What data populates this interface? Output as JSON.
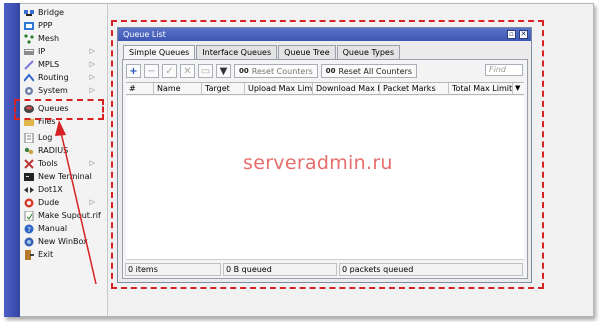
{
  "sidebar": {
    "items": [
      {
        "label": "Bridge",
        "icon": "bridge-icon",
        "arrow": false
      },
      {
        "label": "PPP",
        "icon": "ppp-icon",
        "arrow": false
      },
      {
        "label": "Mesh",
        "icon": "mesh-icon",
        "arrow": false
      },
      {
        "label": "IP",
        "icon": "ip-icon",
        "arrow": true
      },
      {
        "label": "MPLS",
        "icon": "mpls-icon",
        "arrow": true
      },
      {
        "label": "Routing",
        "icon": "routing-icon",
        "arrow": true
      },
      {
        "label": "System",
        "icon": "system-icon",
        "arrow": true
      },
      {
        "label": "Queues",
        "icon": "queues-icon",
        "arrow": false
      },
      {
        "label": "Files",
        "icon": "files-icon",
        "arrow": false
      },
      {
        "label": "Log",
        "icon": "log-icon",
        "arrow": false
      },
      {
        "label": "RADIUS",
        "icon": "radius-icon",
        "arrow": false
      },
      {
        "label": "Tools",
        "icon": "tools-icon",
        "arrow": true
      },
      {
        "label": "New Terminal",
        "icon": "terminal-icon",
        "arrow": false
      },
      {
        "label": "Dot1X",
        "icon": "dot1x-icon",
        "arrow": false
      },
      {
        "label": "Dude",
        "icon": "dude-icon",
        "arrow": true
      },
      {
        "label": "Make Supout.rif",
        "icon": "supout-icon",
        "arrow": false
      },
      {
        "label": "Manual",
        "icon": "manual-icon",
        "arrow": false
      },
      {
        "label": "New WinBox",
        "icon": "winbox-icon",
        "arrow": false
      },
      {
        "label": "Exit",
        "icon": "exit-icon",
        "arrow": false
      }
    ]
  },
  "window": {
    "title": "Queue List",
    "tabs": [
      "Simple Queues",
      "Interface Queues",
      "Queue Tree",
      "Queue Types"
    ],
    "toolbar": {
      "add": "+",
      "reset_counters": "Reset Counters",
      "reset_all_counters": "Reset All Counters",
      "counter_prefix": "00",
      "find_placeholder": "Find"
    },
    "columns": [
      "#",
      "Name",
      "Target",
      "Upload Max Limit",
      "Download Max Limit",
      "Packet Marks",
      "Total Max Limit (bi..."
    ],
    "status": {
      "items": "0 items",
      "queued": "0 B queued",
      "packets": "0 packets queued"
    }
  },
  "watermark": "serveradmin.ru",
  "colors": {
    "highlight": "#d62222",
    "titlebar": "#4a63c0",
    "strip": "#3f50b5"
  }
}
